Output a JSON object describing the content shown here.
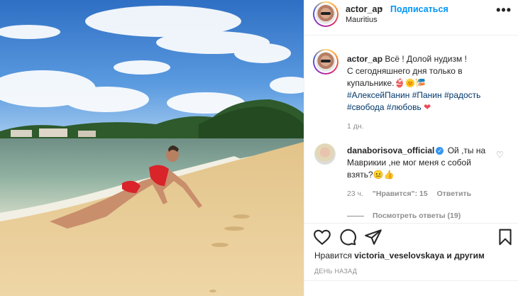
{
  "header": {
    "username": "actor_ap",
    "separator": "•",
    "follow_label": "Подписаться",
    "location": "Mauritius",
    "more_label": "•••"
  },
  "caption": {
    "username": "actor_ap",
    "text_line1": "Всё ! Долой нудизм !",
    "text_line2": "С сегодняшнего дня только в",
    "text_line3": "купальнике.👙🌞🎏",
    "tags_line1": "#АлексейПанин #Панин #радость",
    "tags_line2": "#свобода #любовь",
    "heart": "❤",
    "time": "1 дн."
  },
  "comment": {
    "username": "danaborisova_official",
    "verified_mark": "✓",
    "text": "Ой ,ты на Маврикии ,не мог меня с собой взять?😐👍",
    "like_icon": "♡",
    "time": "23 ч.",
    "likes_label": "\"Нравится\": 15",
    "reply_label": "Ответить",
    "view_replies": "Посмотреть ответы (19)"
  },
  "likes": {
    "prefix": "Нравится",
    "user": "victoria_veselovskaya",
    "suffix": "и другим"
  },
  "date_label": "ДЕНЬ НАЗАД",
  "icons": {
    "like": "heart-outline-icon",
    "comment": "comment-bubble-icon",
    "share": "paper-plane-icon",
    "save": "bookmark-icon"
  },
  "colors": {
    "follow": "#0095f6",
    "hashtag": "#00376b",
    "muted": "#8e8e8e",
    "verified": "#3897f0"
  }
}
